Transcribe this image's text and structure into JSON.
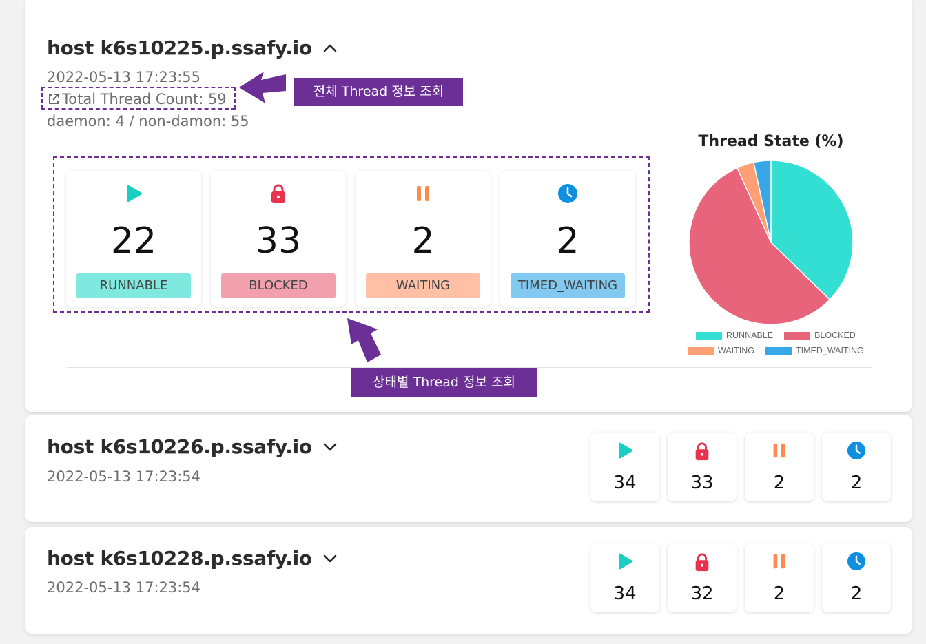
{
  "hosts": [
    {
      "title": "host k6s10225.p.ssafy.io",
      "timestamp": "2022-05-13 17:23:55",
      "total_thread_count": "Total Thread Count: 59",
      "daemon_info": "daemon: 4 / non-damon: 55",
      "states": {
        "runnable": {
          "count": "22",
          "label": "RUNNABLE"
        },
        "blocked": {
          "count": "33",
          "label": "BLOCKED"
        },
        "waiting": {
          "count": "2",
          "label": "WAITING"
        },
        "timed_waiting": {
          "count": "2",
          "label": "TIMED_WAITING"
        }
      },
      "expanded": true
    },
    {
      "title": "host k6s10226.p.ssafy.io",
      "timestamp": "2022-05-13 17:23:54",
      "states": {
        "runnable": "34",
        "blocked": "33",
        "waiting": "2",
        "timed_waiting": "2"
      },
      "expanded": false
    },
    {
      "title": "host k6s10228.p.ssafy.io",
      "timestamp": "2022-05-13 17:23:54",
      "states": {
        "runnable": "34",
        "blocked": "32",
        "waiting": "2",
        "timed_waiting": "2"
      },
      "expanded": false
    }
  ],
  "chart_data": {
    "type": "pie",
    "title": "Thread State (%)",
    "categories": [
      "RUNNABLE",
      "BLOCKED",
      "WAITING",
      "TIMED_WAITING"
    ],
    "values": [
      22,
      33,
      2,
      2
    ],
    "colors": [
      "#33dfd2",
      "#e8647b",
      "#ff9f73",
      "#36a8e8"
    ],
    "legend_position": "bottom"
  },
  "annotations": {
    "total_thread_note": "전체 Thread 정보 조회",
    "state_thread_note": "상태별 Thread 정보 조회"
  },
  "colors": {
    "runnable": "#18cfc1",
    "blocked": "#e8334f",
    "waiting": "#ff8a50",
    "timed_waiting": "#0f8fe0",
    "runnable_label_bg": "#7fe9e0",
    "blocked_label_bg": "#f2a0ae",
    "waiting_label_bg": "#ffc0a6",
    "timed_waiting_label_bg": "#82c9f2",
    "annotation": "#6b2f96"
  },
  "icons": {
    "runnable": "play-icon",
    "blocked": "lock-icon",
    "waiting": "pause-icon",
    "timed_waiting": "clock-icon",
    "expand": "chevron-up-icon",
    "collapse": "chevron-down-icon",
    "link": "external-link-icon"
  }
}
